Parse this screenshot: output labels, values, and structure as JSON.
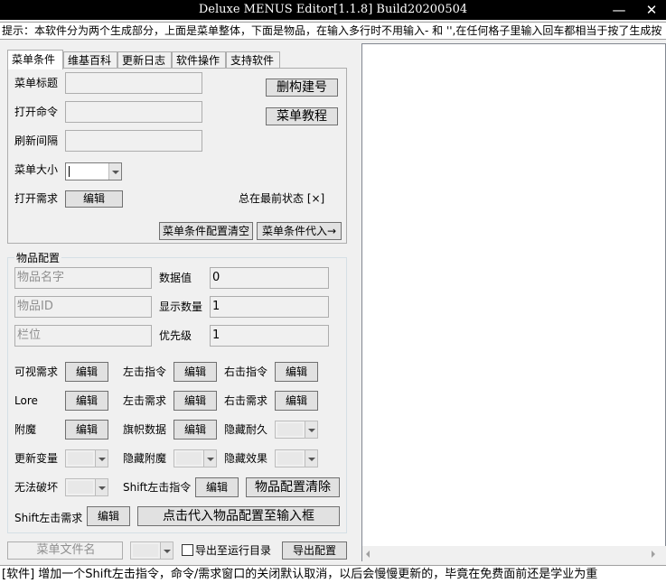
{
  "window": {
    "title": "Deluxe MENUS Editor[1.1.8] Build20200504",
    "minimize_glyph": "—",
    "close_glyph": "✕"
  },
  "tip": "提示：本软件分为两个生成部分，上面是菜单整体，下面是物品，在输入多行时不用输入- 和 '',在任何格子里输入回车都相当于按了生成按",
  "tabs": [
    "菜单条件",
    "维基百科",
    "更新日志",
    "软件操作",
    "支持软件"
  ],
  "menu": {
    "title_label": "菜单标题",
    "open_cmd_label": "打开命令",
    "refresh_label": "刷新间隔",
    "size_label": "菜单大小",
    "open_req_label": "打开需求",
    "edit_label": "编辑",
    "build_btn": "删构建号",
    "tutorial_btn": "菜单教程",
    "topmost": "总在最前状态 [×]",
    "clear_btn": "菜单条件配置清空",
    "apply_btn": "菜单条件代入→"
  },
  "item": {
    "group_title": "物品配置",
    "name_placeholder": "物品名字",
    "id_placeholder": "物品ID",
    "slot_placeholder": "栏位",
    "data_label": "数据值",
    "data_value": "0",
    "amount_label": "显示数量",
    "amount_value": "1",
    "priority_label": "优先级",
    "priority_value": "1",
    "view_req": "可视需求",
    "left_cmd": "左击指令",
    "right_cmd": "右击指令",
    "lore": "Lore",
    "left_req": "左击需求",
    "right_req": "右击需求",
    "enchant": "附魔",
    "banner": "旗帜数据",
    "hide_dur": "隐藏耐久",
    "update_var": "更新变量",
    "hide_ench": "隐藏附魔",
    "hide_eff": "隐藏效果",
    "unbreak": "无法破坏",
    "shift_left_cmd": "Shift左击指令",
    "clear_btn": "物品配置清除",
    "shift_left_req": "Shift左击需求",
    "apply_btn": "点击代入物品配置至输入框",
    "edit_label": "编辑"
  },
  "bottom": {
    "filename_placeholder": "菜单文件名",
    "export_dir": "导出至运行目录",
    "export_btn": "导出配置"
  },
  "status": "[软件] 增加一个Shift左击指令，命令/需求窗口的关闭默认取消，以后会慢慢更新的，毕竟在免费面前还是学业为重"
}
